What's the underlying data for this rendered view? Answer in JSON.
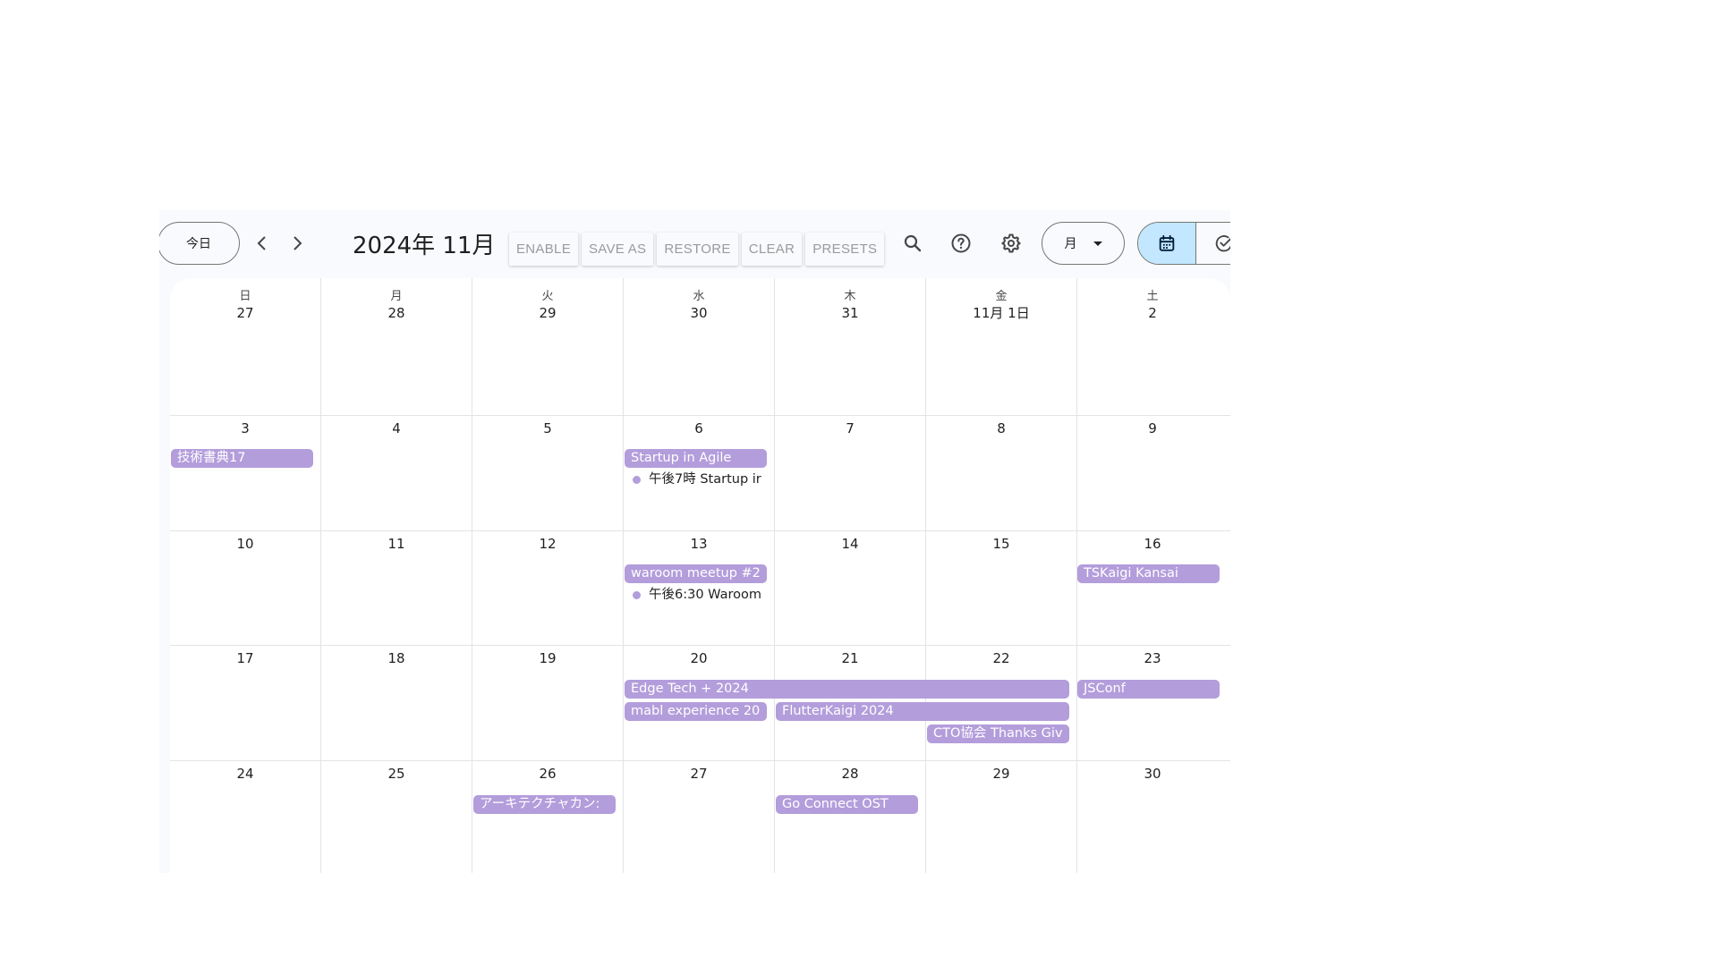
{
  "toolbar": {
    "today_label": "今日",
    "month_title": "2024年 11月",
    "ext_buttons": [
      "ENABLE",
      "SAVE AS",
      "RESTORE",
      "CLEAR",
      "PRESETS"
    ],
    "view_select": "月"
  },
  "calendar": {
    "weekdays": [
      "日",
      "月",
      "火",
      "水",
      "木",
      "金",
      "土"
    ],
    "weeks": [
      [
        "27",
        "28",
        "29",
        "30",
        "31",
        "11月 1日",
        "2"
      ],
      [
        "3",
        "4",
        "5",
        "6",
        "7",
        "8",
        "9"
      ],
      [
        "10",
        "11",
        "12",
        "13",
        "14",
        "15",
        "16"
      ],
      [
        "17",
        "18",
        "19",
        "20",
        "21",
        "22",
        "23"
      ],
      [
        "24",
        "25",
        "26",
        "27",
        "28",
        "29",
        "30"
      ]
    ],
    "events": [
      {
        "title": "技術書典17"
      },
      {
        "title": "Startup in Agile"
      },
      {
        "title": "waroom meetup #2"
      },
      {
        "title": "TSKaigi Kansai"
      },
      {
        "title": "Edge Tech + 2024"
      },
      {
        "title": "JSConf"
      },
      {
        "title": "mabl experience 20"
      },
      {
        "title": "FlutterKaigi 2024"
      },
      {
        "title": "CTO協会 Thanks Giv"
      },
      {
        "title": "アーキテクチャカン:"
      },
      {
        "title": "Go Connect OST"
      }
    ],
    "timed_events": [
      {
        "time": "午後7時",
        "title": "Startup ir"
      },
      {
        "time": "午後6:30",
        "title": "Waroom"
      }
    ]
  },
  "colors": {
    "event": "#b39ddb",
    "toggle_active": "#c2e7ff",
    "background": "#f8fafd"
  }
}
